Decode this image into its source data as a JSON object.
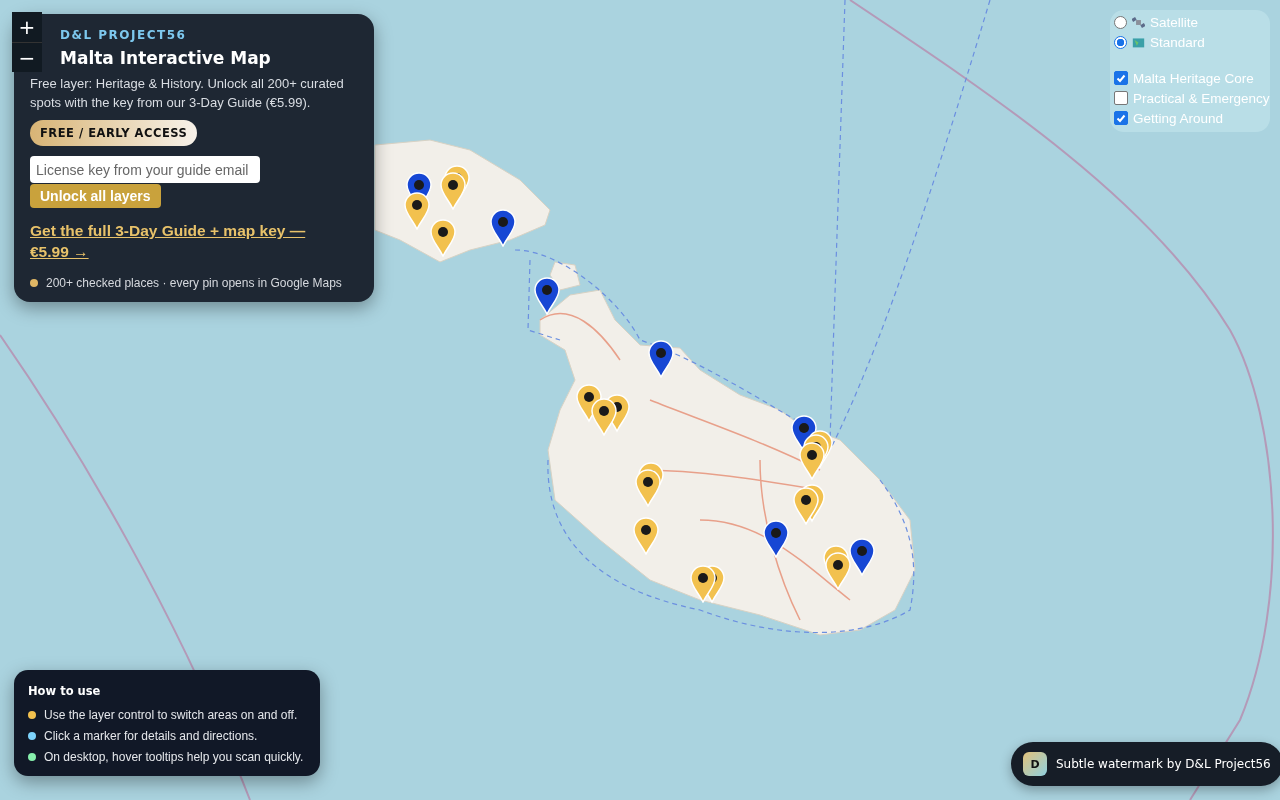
{
  "zoom_control": {
    "zoom_in": "+",
    "zoom_out": "−"
  },
  "info_panel": {
    "brand": "D&L PROJECT56",
    "title": "Malta Interactive Map",
    "description": "Free layer: Heritage & History. Unlock all 200+ curated spots with the key from our 3-Day Guide (€5.99).",
    "badge": "FREE / EARLY ACCESS",
    "license_field": {
      "placeholder": "License key from your guide email"
    },
    "unlock_button": "Unlock all layers",
    "guide_link": "Get the full 3-Day Guide + map key — €5.99 →",
    "note": "200+ checked places · every pin opens in Google Maps"
  },
  "layer_control": {
    "base_layers": [
      {
        "kind": "satellite",
        "label": "Satellite",
        "selected": false
      },
      {
        "kind": "standard",
        "label": "Standard",
        "selected": true
      }
    ],
    "overlays": [
      {
        "label": "Malta Heritage Core",
        "checked": true
      },
      {
        "label": "Practical & Emergency",
        "checked": false
      },
      {
        "label": "Getting Around",
        "checked": true
      }
    ]
  },
  "markers": [
    {
      "pins": [
        {
          "color": "#f2c14e"
        },
        {
          "color": "#f2c14e"
        }
      ]
    },
    {
      "pins": [
        {
          "color": "#1747d4"
        },
        {
          "color": "#f2c14e"
        }
      ]
    },
    {
      "pins": [
        {
          "color": "#f2c14e"
        }
      ]
    },
    {
      "pins": [
        {
          "color": "#1747d4"
        }
      ]
    },
    {
      "pins": [
        {
          "color": "#1747d4"
        }
      ]
    },
    {
      "pins": [
        {
          "color": "#1747d4"
        }
      ]
    },
    {
      "pins": [
        {
          "color": "#f2c14e"
        },
        {
          "color": "#f2c14e"
        },
        {
          "color": "#f2c14e"
        }
      ]
    },
    {
      "pins": [
        {
          "color": "#1747d4"
        },
        {
          "color": "#f2c14e"
        },
        {
          "color": "#f2c14e"
        },
        {
          "color": "#f2c14e"
        }
      ]
    },
    {
      "pins": [
        {
          "color": "#f2c14e"
        },
        {
          "color": "#f2c14e"
        }
      ]
    },
    {
      "pins": [
        {
          "color": "#f2c14e"
        },
        {
          "color": "#f2c14e"
        }
      ]
    },
    {
      "pins": [
        {
          "color": "#1747d4"
        }
      ]
    },
    {
      "pins": [
        {
          "color": "#f2c14e"
        }
      ]
    },
    {
      "pins": [
        {
          "color": "#f2c14e"
        },
        {
          "color": "#f2c14e"
        }
      ]
    },
    {
      "pins": [
        {
          "color": "#f2c14e"
        },
        {
          "color": "#f2c14e"
        }
      ]
    },
    {
      "pins": [
        {
          "color": "#1747d4"
        }
      ]
    }
  ],
  "how_to_use": {
    "title": "How to use",
    "items": [
      {
        "text": "Use the layer control to switch areas on and off.",
        "color": "#f2c14e"
      },
      {
        "text": "Click a marker for details and directions.",
        "color": "#7dd3fc"
      },
      {
        "text": "On desktop, hover tooltips help you scan quickly.",
        "color": "#86efac"
      }
    ]
  },
  "credit_badge": {
    "initial": "D",
    "text": "Subtle watermark by D&L Project56"
  }
}
